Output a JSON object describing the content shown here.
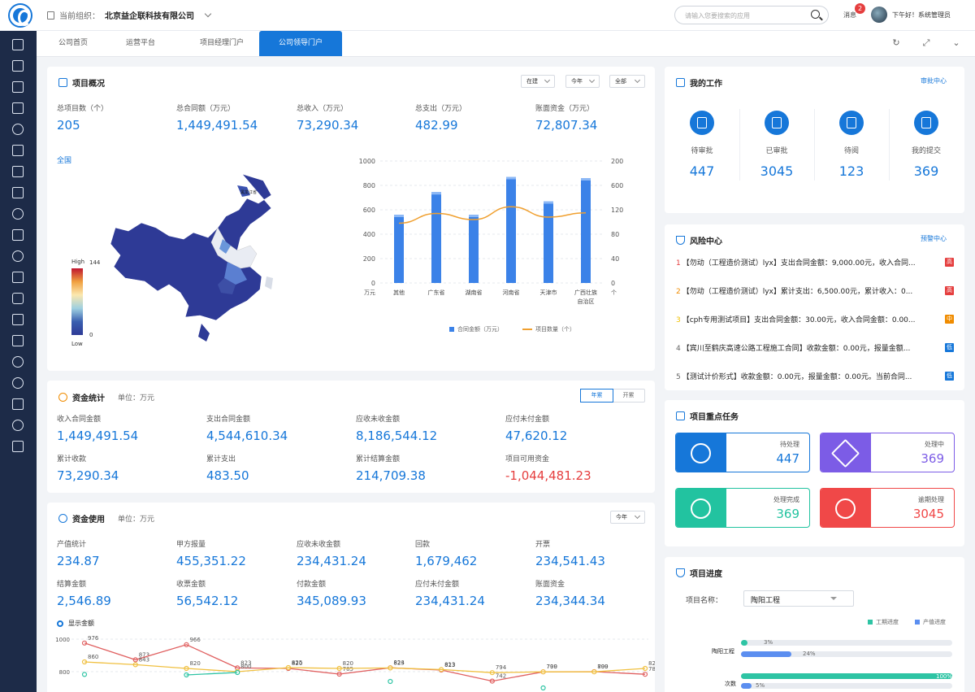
{
  "header": {
    "org_label": "当前组织：",
    "org_name": "北京益企联科技有限公司",
    "search_placeholder": "请输入您要搜索的应用",
    "msg_label": "消息",
    "msg_count": "2",
    "greeting": "下午好！系统管理员"
  },
  "tabs": [
    {
      "label": "公司首页"
    },
    {
      "label": "运营平台"
    },
    {
      "label": "项目经理门户"
    },
    {
      "label": "公司领导门户"
    }
  ],
  "overview": {
    "title": "项目概况",
    "filters": [
      "在建",
      "今年",
      "全部"
    ],
    "stats": [
      {
        "label": "总项目数（个）",
        "value": "205"
      },
      {
        "label": "总合同额（万元）",
        "value": "1,449,491.54"
      },
      {
        "label": "总收入（万元）",
        "value": "73,290.34"
      },
      {
        "label": "总支出（万元）",
        "value": "482.99"
      },
      {
        "label": "账面资金（万元）",
        "value": "72,807.34"
      }
    ],
    "map": {
      "region_label": "全国",
      "scale_high": "High",
      "scale_low": "Low",
      "scale_max": "144",
      "scale_min": "0",
      "province_label": "黑龙江省"
    }
  },
  "chart_data": {
    "type": "bar",
    "categories": [
      "其他",
      "广东省",
      "湖南省",
      "河南省",
      "天津市",
      "广西壮族自治区"
    ],
    "series": [
      {
        "name": "合同金额（万元）",
        "type": "bar",
        "values": [
          560,
          745,
          560,
          870,
          670,
          860
        ]
      },
      {
        "name": "项目数量（个）",
        "type": "line",
        "values": [
          490,
          570,
          520,
          625,
          540,
          575
        ]
      }
    ],
    "y_left": {
      "ticks": [
        "1000",
        "800",
        "600",
        "400",
        "200",
        "0"
      ],
      "unit": "万元",
      "min": 0,
      "max": 1000
    },
    "y_right": {
      "ticks": [
        "200",
        "600",
        "120",
        "80",
        "40",
        "0"
      ],
      "unit": "个"
    }
  },
  "funds": {
    "title": "资金统计",
    "unit": "单位：万元",
    "toggle": [
      "年累",
      "开累"
    ],
    "stats": [
      {
        "label": "收入合同金额",
        "value": "1,449,491.54"
      },
      {
        "label": "支出合同金额",
        "value": "4,544,610.34"
      },
      {
        "label": "应收未收金额",
        "value": "8,186,544.12"
      },
      {
        "label": "应付未付金额",
        "value": "47,620.12"
      },
      {
        "label": "累计收款",
        "value": "73,290.34"
      },
      {
        "label": "累计支出",
        "value": "483.50"
      },
      {
        "label": "累计结算金额",
        "value": "214,709.38"
      },
      {
        "label": "项目可用资金",
        "value": "-1,044,481.23"
      }
    ]
  },
  "usage": {
    "title": "资金使用",
    "unit": "单位：万元",
    "filter": "今年",
    "show_amount": "显示金额",
    "stats": [
      {
        "label": "产值统计",
        "value": "234.87"
      },
      {
        "label": "甲方报量",
        "value": "455,351.22"
      },
      {
        "label": "应收未收金额",
        "value": "234,431.24"
      },
      {
        "label": "回款",
        "value": "1,679,462"
      },
      {
        "label": "开票",
        "value": "234,541.43"
      },
      {
        "label": "结算金额",
        "value": "2,546.89"
      },
      {
        "label": "收票金额",
        "value": "56,542.12"
      },
      {
        "label": "付款金额",
        "value": "345,089.93"
      },
      {
        "label": "应付未付金额",
        "value": "234,431.24"
      },
      {
        "label": "账面资金",
        "value": "234,344.34"
      }
    ],
    "line_chart": {
      "y_ticks": [
        "1000",
        "800"
      ],
      "red": [
        976,
        873,
        966,
        823,
        820,
        785,
        824,
        810,
        742,
        799,
        800,
        784
      ],
      "yellow": [
        860,
        843,
        820,
        800,
        825,
        820,
        823,
        813,
        794,
        799,
        799,
        820
      ],
      "green": [
        783,
        null,
        780,
        795,
        null,
        null,
        740,
        null,
        null,
        700,
        null,
        null
      ],
      "red_labels": [
        "976",
        "873",
        "966",
        "823",
        "820",
        "785",
        "824",
        "823",
        "742",
        "799",
        "800",
        "784"
      ],
      "yellow_labels": [
        "860",
        "843",
        "820",
        "800",
        "825",
        "820",
        "823",
        "813",
        "794",
        "700",
        "799",
        "820"
      ]
    }
  },
  "work": {
    "title": "我的工作",
    "link": "审批中心",
    "items": [
      {
        "label": "待审批",
        "value": "447"
      },
      {
        "label": "已审批",
        "value": "3045"
      },
      {
        "label": "待阅",
        "value": "123"
      },
      {
        "label": "我的提交",
        "value": "369"
      }
    ]
  },
  "risk": {
    "title": "风险中心",
    "link": "预警中心",
    "items": [
      {
        "n": "1",
        "text": "【勿动（工程造价测试）lyx】支出合同金额：9,000.00元，收入合同...",
        "tag": "高",
        "color": "#e53e3e",
        "ncolor": "#e53e3e"
      },
      {
        "n": "2",
        "text": "【勿动（工程造价测试）lyx】累计支出：6,500.00元，累计收入：0...",
        "tag": "高",
        "color": "#e53e3e",
        "ncolor": "#f08c00"
      },
      {
        "n": "3",
        "text": "【cph专用测试项目】支出合同金额：30.00元，收入合同金额：0.00...",
        "tag": "中",
        "color": "#f08c00",
        "ncolor": "#f0c000"
      },
      {
        "n": "4",
        "text": "【宾川至鹤庆高速公路工程施工合同】收款金额：0.00元，报量金额...",
        "tag": "低",
        "color": "#1677d9",
        "ncolor": "#666"
      },
      {
        "n": "5",
        "text": "【测试计价形式】收款金额：0.00元，报量金额：0.00元。当前合同...",
        "tag": "低",
        "color": "#1677d9",
        "ncolor": "#666"
      }
    ]
  },
  "tasks": {
    "title": "项目重点任务",
    "items": [
      {
        "label": "待处理",
        "value": "447",
        "color": "#1677d9"
      },
      {
        "label": "处理中",
        "value": "369",
        "color": "#7c5ce6"
      },
      {
        "label": "处理完成",
        "value": "369",
        "color": "#22c3a0"
      },
      {
        "label": "逾期处理",
        "value": "3045",
        "color": "#f04848"
      }
    ]
  },
  "progress": {
    "title": "项目进度",
    "name_label": "项目名称：",
    "name_value": "陶阳工程",
    "legend": [
      "工期进度",
      "产值进度"
    ],
    "rows": [
      {
        "label": "陶阳工程",
        "a": "3%",
        "a_val": 0.03,
        "b": "24%",
        "b_val": 0.24
      },
      {
        "label": "次数",
        "a": "100%",
        "a_val": 1.0,
        "b": "5%",
        "b_val": 0.05
      }
    ]
  }
}
